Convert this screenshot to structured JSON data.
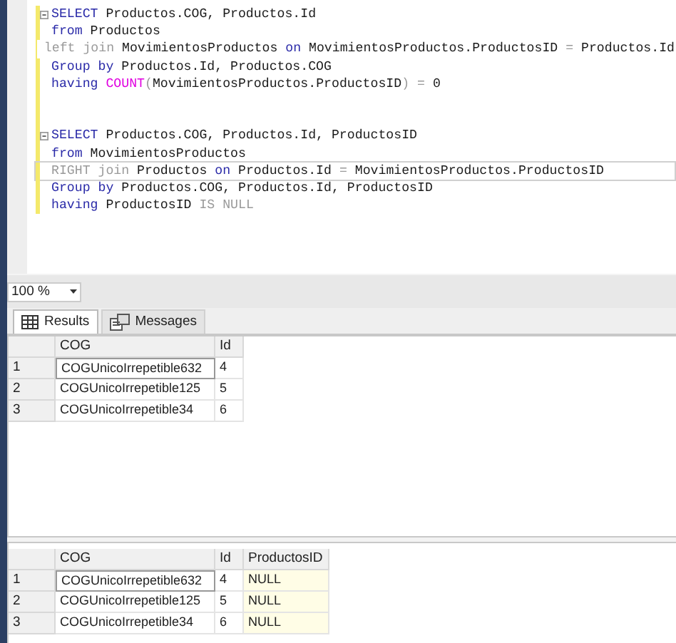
{
  "editor": {
    "lines": [
      {
        "fold": true,
        "current": false,
        "tokens": [
          {
            "kind": "keyword",
            "t": "SELECT"
          },
          {
            "kind": "plain",
            "t": " Productos.COG, Productos.Id"
          }
        ]
      },
      {
        "fold": false,
        "current": false,
        "tokens": [
          {
            "kind": "keyword",
            "t": "from"
          },
          {
            "kind": "plain",
            "t": " Productos"
          }
        ]
      },
      {
        "fold": false,
        "current": false,
        "tokens": [
          {
            "kind": "grey",
            "t": "left join"
          },
          {
            "kind": "plain",
            "t": " MovimientosProductos "
          },
          {
            "kind": "keyword",
            "t": "on"
          },
          {
            "kind": "plain",
            "t": " MovimientosProductos.ProductosID "
          },
          {
            "kind": "grey",
            "t": "="
          },
          {
            "kind": "plain",
            "t": " Productos.Id"
          }
        ]
      },
      {
        "fold": false,
        "current": false,
        "tokens": [
          {
            "kind": "keyword",
            "t": "Group by"
          },
          {
            "kind": "plain",
            "t": " Productos.Id, Productos.COG"
          }
        ]
      },
      {
        "fold": false,
        "current": false,
        "tokens": [
          {
            "kind": "keyword",
            "t": "having"
          },
          {
            "kind": "func",
            "t": " COUNT"
          },
          {
            "kind": "grey",
            "t": "("
          },
          {
            "kind": "plain",
            "t": "MovimientosProductos.ProductosID"
          },
          {
            "kind": "grey",
            "t": ") ="
          },
          {
            "kind": "plain",
            "t": " 0"
          }
        ]
      },
      {
        "fold": false,
        "current": false
      },
      {
        "fold": false,
        "current": false
      },
      {
        "fold": true,
        "current": false,
        "tokens": [
          {
            "kind": "keyword",
            "t": "SELECT"
          },
          {
            "kind": "plain",
            "t": " Productos.COG, Productos.Id, ProductosID"
          }
        ]
      },
      {
        "fold": false,
        "current": false,
        "tokens": [
          {
            "kind": "keyword",
            "t": "from"
          },
          {
            "kind": "plain",
            "t": " MovimientosProductos"
          }
        ]
      },
      {
        "fold": false,
        "current": true,
        "tokens": [
          {
            "kind": "grey",
            "t": "RIGHT join"
          },
          {
            "kind": "plain",
            "t": " Productos "
          },
          {
            "kind": "keyword",
            "t": "on"
          },
          {
            "kind": "plain",
            "t": " Productos.Id "
          },
          {
            "kind": "grey",
            "t": "="
          },
          {
            "kind": "plain",
            "t": " MovimientosProductos.ProductosID"
          }
        ]
      },
      {
        "fold": false,
        "current": false,
        "tokens": [
          {
            "kind": "keyword",
            "t": "Group by"
          },
          {
            "kind": "plain",
            "t": " Productos.COG, Productos.Id, ProductosID"
          }
        ]
      },
      {
        "fold": false,
        "current": false,
        "tokens": [
          {
            "kind": "keyword",
            "t": "having"
          },
          {
            "kind": "plain",
            "t": " ProductosID "
          },
          {
            "kind": "grey",
            "t": "IS NULL"
          }
        ]
      }
    ]
  },
  "zoom": {
    "value": "100 %"
  },
  "tabs": [
    {
      "label": "Results",
      "kind": "grid",
      "selected": true
    },
    {
      "label": "Messages",
      "kind": "messages",
      "selected": false
    }
  ],
  "grids": [
    {
      "columns": [
        "COG",
        "Id"
      ],
      "rows": [
        {
          "number": "1",
          "cells": [
            {
              "text": "COGUnicoIrrepetible632",
              "selected": true,
              "kind": "value"
            },
            {
              "text": "4",
              "selected": false,
              "kind": "value"
            }
          ]
        },
        {
          "number": "2",
          "cells": [
            {
              "text": "COGUnicoIrrepetible125",
              "selected": false,
              "kind": "value"
            },
            {
              "text": "5",
              "selected": false,
              "kind": "value"
            }
          ]
        },
        {
          "number": "3",
          "cells": [
            {
              "text": "COGUnicoIrrepetible34",
              "selected": false,
              "kind": "value"
            },
            {
              "text": "6",
              "selected": false,
              "kind": "value"
            }
          ]
        }
      ]
    },
    {
      "columns": [
        "COG",
        "Id",
        "ProductosID"
      ],
      "rows": [
        {
          "number": "1",
          "cells": [
            {
              "text": "COGUnicoIrrepetible632",
              "selected": true,
              "kind": "value"
            },
            {
              "text": "4",
              "selected": false,
              "kind": "value"
            },
            {
              "text": "NULL",
              "selected": false,
              "kind": "null"
            }
          ]
        },
        {
          "number": "2",
          "cells": [
            {
              "text": "COGUnicoIrrepetible125",
              "selected": false,
              "kind": "value"
            },
            {
              "text": "5",
              "selected": false,
              "kind": "value"
            },
            {
              "text": "NULL",
              "selected": false,
              "kind": "null"
            }
          ]
        },
        {
          "number": "3",
          "cells": [
            {
              "text": "COGUnicoIrrepetible34",
              "selected": false,
              "kind": "value"
            },
            {
              "text": "6",
              "selected": false,
              "kind": "value"
            },
            {
              "text": "NULL",
              "selected": false,
              "kind": "null"
            }
          ]
        }
      ]
    }
  ]
}
